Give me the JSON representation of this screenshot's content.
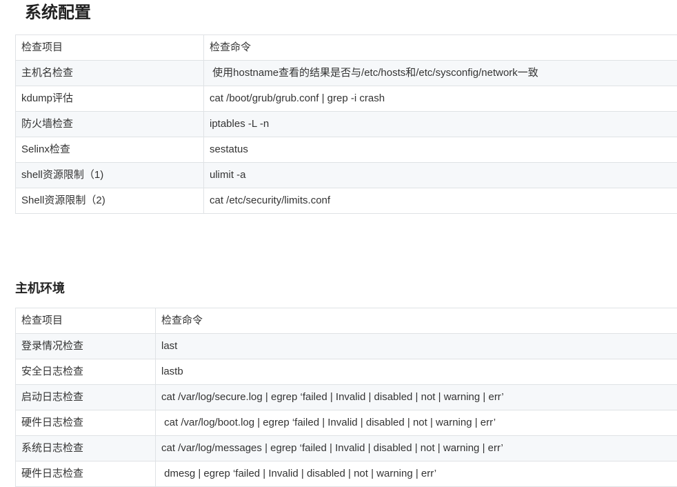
{
  "section1": {
    "title": "系统配置",
    "header": [
      "检查项目",
      "检查命令"
    ],
    "rows": [
      [
        "主机名检查",
        " 使用hostname查看的结果是否与/etc/hosts和/etc/sysconfig/network一致"
      ],
      [
        "kdump评估",
        "cat /boot/grub/grub.conf | grep -i crash"
      ],
      [
        "防火墙检查",
        "iptables -L -n"
      ],
      [
        "Selinx检查",
        "sestatus"
      ],
      [
        "shell资源限制（1)",
        "ulimit -a"
      ],
      [
        "Shell资源限制（2)",
        "cat /etc/security/limits.conf"
      ]
    ]
  },
  "section2": {
    "title": "主机环境",
    "header": [
      "检查项目",
      "检查命令"
    ],
    "rows": [
      [
        "登录情况检查",
        "last"
      ],
      [
        "安全日志检查",
        "lastb"
      ],
      [
        "启动日志检查",
        "cat /var/log/secure.log | egrep ‘failed | Invalid | disabled | not | warning | err’"
      ],
      [
        "硬件日志检查",
        " cat /var/log/boot.log | egrep ‘failed | Invalid | disabled | not | warning | err’"
      ],
      [
        "系统日志检查",
        "cat /var/log/messages | egrep ‘failed | Invalid | disabled | not | warning | err’"
      ],
      [
        "硬件日志检查",
        " dmesg | egrep ‘failed | Invalid | disabled | not | warning | err’"
      ]
    ]
  }
}
